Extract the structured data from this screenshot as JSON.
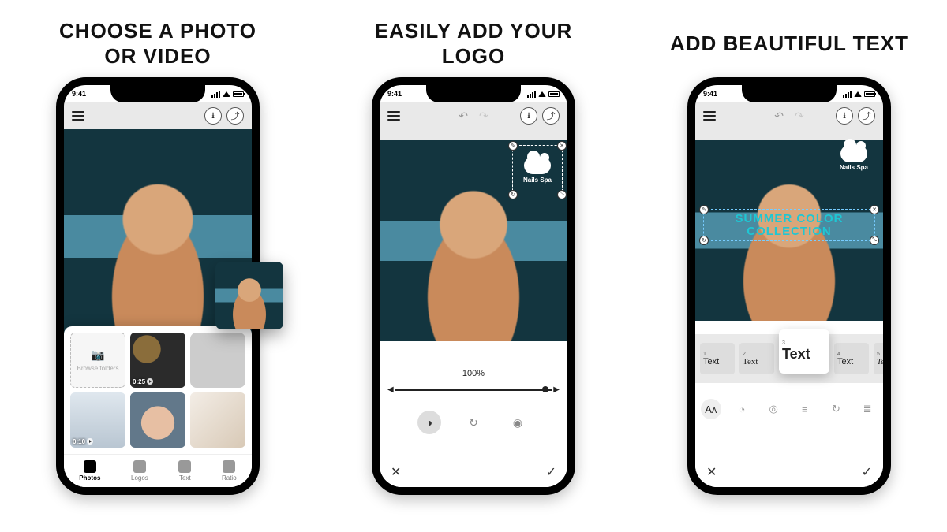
{
  "headings": {
    "col1": "CHOOSE A PHOTO\nOR VIDEO",
    "col2": "EASILY ADD YOUR\nLOGO",
    "col3": "ADD BEAUTIFUL TEXT"
  },
  "status_time": "9:41",
  "screen1": {
    "browse_label": "Browse folders",
    "thumbs": [
      {
        "duration": "0:25"
      },
      {
        "duration": null
      },
      {
        "duration": "0:10"
      },
      {
        "duration": null
      },
      {
        "duration": null
      }
    ],
    "tabs": [
      "Photos",
      "Logos",
      "Text",
      "Ratio"
    ],
    "active_tab": 0
  },
  "screen2": {
    "logo_text": "Nails Spa",
    "zoom_label": "100%"
  },
  "screen3": {
    "logo_text": "Nails Spa",
    "overlay_text": "SUMMER COLOR\nCOLLECTION",
    "font_options": [
      "Text",
      "Text",
      "Text",
      "Text",
      "Text"
    ],
    "selected_font_index": 2
  },
  "icons": {
    "download": "⭳",
    "share": "⤴",
    "undo": "↶",
    "redo": "↷",
    "close": "✕",
    "check": "✓",
    "reload": "↻",
    "eye": "◉",
    "opacity": "◑",
    "font": "Aᴀ",
    "palette": "◔",
    "shadow": "◎",
    "lineheight": "≡",
    "align": "≣",
    "camera": "📷",
    "edit": "✎"
  }
}
